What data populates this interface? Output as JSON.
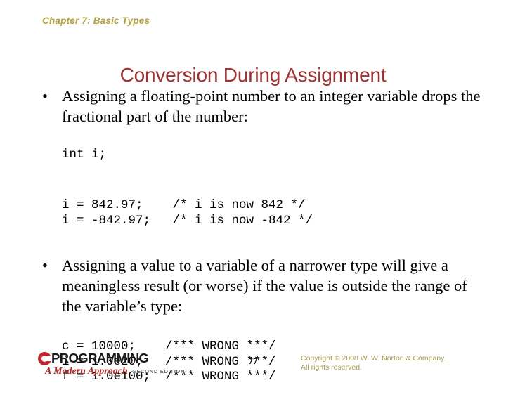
{
  "slide": {
    "chapter_header": "Chapter 7: Basic Types",
    "title": "Conversion During Assignment",
    "bullets": [
      {
        "marker": "•",
        "text": "Assigning a floating-point number to an integer variable drops the fractional part of the number:"
      },
      {
        "marker": "•",
        "text": "Assigning a value to a variable of a narrower type will give a meaningless result (or worse) if the value is outside the range of the variable’s type:"
      }
    ],
    "code_blocks": [
      {
        "lines": [
          "int i;"
        ]
      },
      {
        "lines": [
          "i = 842.97;    /* i is now 842 */",
          "i = -842.97;   /* i is now -842 */"
        ]
      },
      {
        "lines": [
          "c = 10000;    /*** WRONG ***/",
          "i = 1.0e20;   /*** WRONG ***/",
          "f = 1.0e100;  /*** WRONG ***/"
        ]
      }
    ]
  },
  "footer": {
    "logo": {
      "mark": "C",
      "word": "PROGRAMMING",
      "subtitle": "A Modern Approach",
      "edition": "SECOND EDITION"
    },
    "page_number": "77",
    "copyright_line1": "Copyright © 2008 W. W. Norton & Company.",
    "copyright_line2": "All rights reserved."
  },
  "colors": {
    "title_red": "#9e3232",
    "header_khaki": "#b0a23f",
    "copyright_khaki": "#a89a4f",
    "logo_red": "#c1272d",
    "body_black": "#000000",
    "background": "#ffffff"
  }
}
